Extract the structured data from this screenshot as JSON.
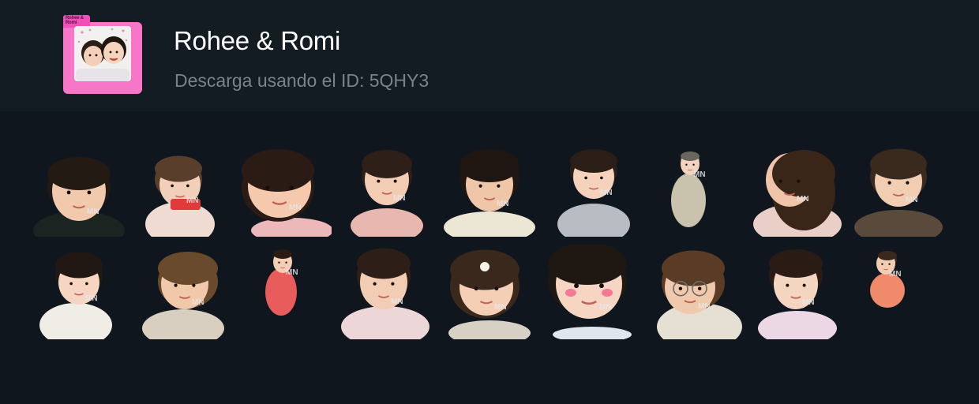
{
  "pack": {
    "title": "Rohee & Romi",
    "download_text": "Descarga usando el ID: 5QHY3",
    "icon_tab_text": "Rohee & Romi"
  },
  "watermark": "MN",
  "colors": {
    "page_bg": "#0f161e",
    "header_bg": "#131b23",
    "title": "#ffffff",
    "subtitle": "#7a828b",
    "folder_pink": "#f876c8"
  },
  "stickers": [
    {
      "name": "sticker-boy-black-shirt",
      "hair": "#241a14",
      "cloth": "#1c2422",
      "skin": "#f1c9ad"
    },
    {
      "name": "sticker-girl-reading-red-book",
      "hair": "#5a3e2c",
      "cloth": "#f0dbd2",
      "skin": "#f2cfb8"
    },
    {
      "name": "sticker-girl-pink-shirt-closeup",
      "hair": "#2a1b14",
      "cloth": "#ecb8ba",
      "skin": "#f4c9ad"
    },
    {
      "name": "sticker-girl-smiling-pink",
      "hair": "#2e2018",
      "cloth": "#e8b7b0",
      "skin": "#f2cdb4"
    },
    {
      "name": "sticker-girl-cream-sweater",
      "hair": "#1f1611",
      "cloth": "#ece6d4",
      "skin": "#f0c6a8"
    },
    {
      "name": "sticker-boy-grey-shirt",
      "hair": "#2a1e17",
      "cloth": "#b9bcc3",
      "skin": "#f4d2bc"
    },
    {
      "name": "sticker-girl-arms-up",
      "hair": "#6a665e",
      "cloth": "#c9c3ad",
      "skin": "#f3d3bd"
    },
    {
      "name": "sticker-girls-hugging",
      "hair": "#3a2618",
      "cloth": "#e9cfc7",
      "skin": "#efc4a8"
    },
    {
      "name": "sticker-girl-drinking-cup",
      "hair": "#3a2a1e",
      "cloth": "#5a4a3c",
      "skin": "#f1cdb2"
    },
    {
      "name": "sticker-girl-hands-together",
      "hair": "#221813",
      "cloth": "#f0ece6",
      "skin": "#f6d6c2"
    },
    {
      "name": "sticker-girl-hand-on-cheek",
      "hair": "#6a4a2c",
      "cloth": "#d8cfc0",
      "skin": "#f1c8aa"
    },
    {
      "name": "sticker-girl-red-top-standing",
      "hair": "#2a1c14",
      "cloth": "#e85c5c",
      "skin": "#f3ceb4"
    },
    {
      "name": "sticker-girl-hands-on-face",
      "hair": "#2d1f17",
      "cloth": "#ecd6d8",
      "skin": "#f2ccb3"
    },
    {
      "name": "sticker-girl-flower-clip",
      "hair": "#3a281c",
      "cloth": "#d7d0c4",
      "skin": "#f4cfb5"
    },
    {
      "name": "sticker-girl-blushing",
      "hair": "#1e1712",
      "cloth": "#dfe6ee",
      "skin": "#f7d5c3"
    },
    {
      "name": "sticker-girl-glasses-blanket",
      "hair": "#5a3c26",
      "cloth": "#e6e0d4",
      "skin": "#f0c9ad"
    },
    {
      "name": "sticker-girl-lying-cheek",
      "hair": "#2a1c14",
      "cloth": "#ecd8e4",
      "skin": "#f4d5c0"
    },
    {
      "name": "sticker-girl-jumping-orange",
      "hair": "#3a281c",
      "cloth": "#f08a6a",
      "skin": "#f3cdb2"
    }
  ]
}
